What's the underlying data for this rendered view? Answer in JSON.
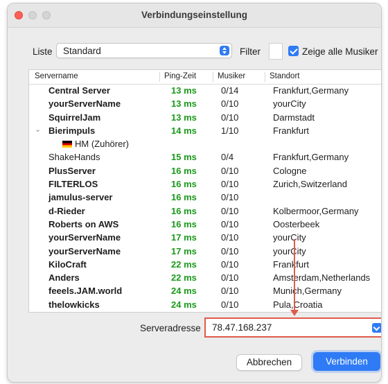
{
  "window": {
    "title": "Verbindungseinstellung"
  },
  "controls": {
    "liste_label": "Liste",
    "liste_value": "Standard",
    "filter_label": "Filter",
    "filter_value": "",
    "show_all_label": "Zeige alle Musiker",
    "show_all_checked": true
  },
  "table": {
    "headers": [
      "Servername",
      "Ping-Zeit",
      "Musiker",
      "Standort"
    ],
    "rows": [
      {
        "name": "Central Server",
        "ping": "13 ms",
        "musicians": "0/14",
        "location": "Frankfurt,Germany",
        "bold": true
      },
      {
        "name": "yourServerName",
        "ping": "13 ms",
        "musicians": "0/10",
        "location": "yourCity",
        "bold": true
      },
      {
        "name": "SquirrelJam",
        "ping": "13 ms",
        "musicians": "0/10",
        "location": "Darmstadt",
        "bold": true
      },
      {
        "name": "Bierimpuls",
        "ping": "14 ms",
        "musicians": "1/10",
        "location": "Frankfurt",
        "bold": true,
        "expanded": true,
        "children": [
          {
            "name": "HM (Zuhörer)",
            "flag": "germany-flag"
          }
        ]
      },
      {
        "name": "ShakeHands",
        "ping": "15 ms",
        "musicians": "0/4",
        "location": "Frankfurt,Germany",
        "bold": false
      },
      {
        "name": "PlusServer",
        "ping": "16 ms",
        "musicians": "0/10",
        "location": "Cologne",
        "bold": true
      },
      {
        "name": "FILTERLOS",
        "ping": "16 ms",
        "musicians": "0/10",
        "location": "Zurich,Switzerland",
        "bold": true
      },
      {
        "name": "jamulus-server",
        "ping": "16 ms",
        "musicians": "0/10",
        "location": "",
        "bold": true
      },
      {
        "name": "d-Rieder",
        "ping": "16 ms",
        "musicians": "0/10",
        "location": "Kolbermoor,Germany",
        "bold": true
      },
      {
        "name": "Roberts on AWS",
        "ping": "16 ms",
        "musicians": "0/10",
        "location": "Oosterbeek",
        "bold": true
      },
      {
        "name": "yourServerName",
        "ping": "17 ms",
        "musicians": "0/10",
        "location": "yourCity",
        "bold": true
      },
      {
        "name": "yourServerName",
        "ping": "17 ms",
        "musicians": "0/10",
        "location": "yourCity",
        "bold": true
      },
      {
        "name": "KiloCraft",
        "ping": "22 ms",
        "musicians": "0/10",
        "location": "Frankfurt",
        "bold": true
      },
      {
        "name": "Anders",
        "ping": "22 ms",
        "musicians": "0/10",
        "location": "Amsterdam,Netherlands",
        "bold": true
      },
      {
        "name": "feeels.JAM.world",
        "ping": "24 ms",
        "musicians": "0/10",
        "location": "Munich,Germany",
        "bold": true
      },
      {
        "name": "thelowkicks",
        "ping": "24 ms",
        "musicians": "0/10",
        "location": "Pula,Croatia",
        "bold": true
      }
    ]
  },
  "address": {
    "label": "Serveradresse",
    "value": "78.47.168.237"
  },
  "buttons": {
    "cancel": "Abbrechen",
    "connect": "Verbinden"
  },
  "colors": {
    "accent": "#2f7bf5",
    "ping_green": "#1a9a1a",
    "highlight_red": "#e05a4a"
  }
}
